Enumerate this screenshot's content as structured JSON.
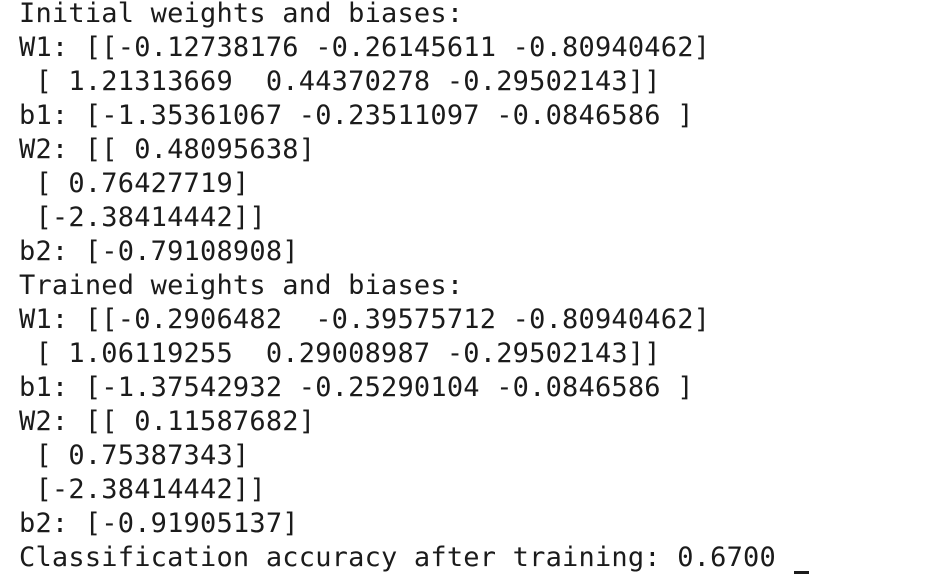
{
  "terminal": {
    "lines": [
      "Initial weights and biases:",
      "W1: [[-0.12738176 -0.26145611 -0.80940462]",
      " [ 1.21313669  0.44370278 -0.29502143]]",
      "b1: [-1.35361067 -0.23511097 -0.0846586 ]",
      "W2: [[ 0.48095638]",
      " [ 0.76427719]",
      " [-2.38414442]]",
      "b2: [-0.79108908]",
      "Trained weights and biases:",
      "W1: [[-0.2906482  -0.39575712 -0.80940462]",
      " [ 1.06119255  0.29008987 -0.29502143]]",
      "b1: [-1.37542932 -0.25290104 -0.0846586 ]",
      "W2: [[ 0.11587682]",
      " [ 0.75387343]",
      " [-2.38414442]]",
      "b2: [-0.91905137]",
      "Classification accuracy after training: 0.6700 "
    ]
  }
}
